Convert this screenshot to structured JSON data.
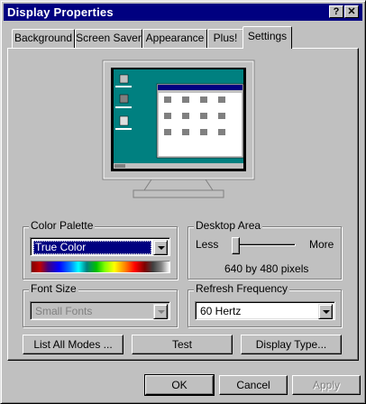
{
  "window": {
    "title": "Display Properties",
    "help_button": "?",
    "close_button": "✕"
  },
  "tabs": [
    {
      "label": "Background"
    },
    {
      "label": "Screen Saver"
    },
    {
      "label": "Appearance"
    },
    {
      "label": "Plus!"
    },
    {
      "label": "Settings",
      "active": true
    }
  ],
  "color_palette": {
    "label": "Color Palette",
    "value": "True Color"
  },
  "desktop_area": {
    "label": "Desktop Area",
    "less": "Less",
    "more": "More",
    "resolution": "640 by 480 pixels",
    "slider_level": 0.0
  },
  "font_size": {
    "label": "Font Size",
    "value": "Small Fonts"
  },
  "refresh_frequency": {
    "label": "Refresh Frequency",
    "value": "60 Hertz"
  },
  "buttons": {
    "list_all_modes": "List All Modes ...",
    "test": "Test",
    "display_type": "Display Type...",
    "ok": "OK",
    "cancel": "Cancel",
    "apply": "Apply"
  },
  "colors": {
    "titlebar": "#000080",
    "face": "#c0c0c0",
    "desktop": "#008080"
  }
}
